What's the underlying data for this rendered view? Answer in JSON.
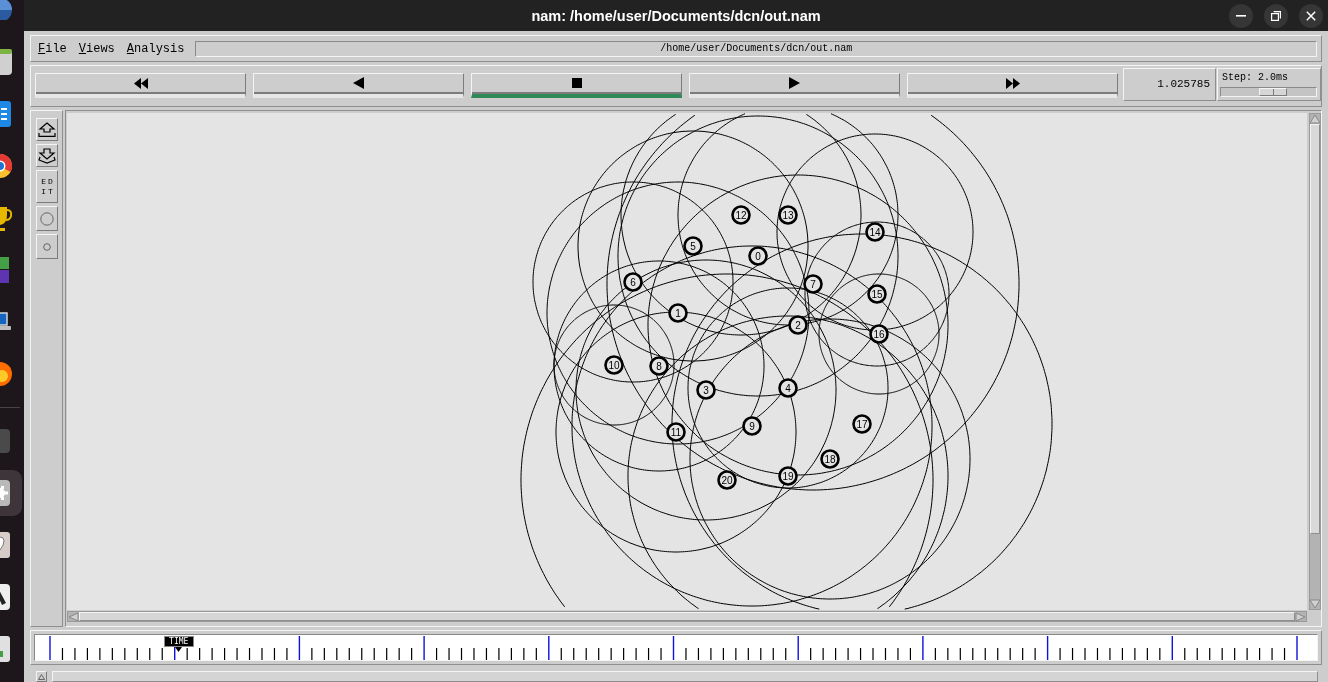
{
  "window": {
    "title": "nam: /home/user/Documents/dcn/out.nam",
    "controls": [
      {
        "kind": "minimize"
      },
      {
        "kind": "maximize"
      },
      {
        "kind": "close"
      }
    ]
  },
  "dock": {
    "items": [
      {
        "selected": false
      },
      {
        "selected": false
      },
      {
        "selected": false
      },
      {
        "selected": false
      },
      {
        "selected": false
      },
      {
        "selected": false
      },
      {
        "selected": false
      },
      {
        "selected": false
      },
      {
        "selected": false
      },
      {
        "selected": true
      },
      {
        "selected": false
      },
      {
        "selected": false
      },
      {
        "selected": false
      }
    ]
  },
  "menu": {
    "items": [
      {
        "label": "File"
      },
      {
        "label": "Views"
      },
      {
        "label": "Analysis"
      }
    ],
    "file_path": "/home/user/Documents/dcn/out.nam"
  },
  "playback": {
    "buttons": [
      {
        "kind": "rewind",
        "selected": false
      },
      {
        "kind": "back",
        "selected": false
      },
      {
        "kind": "stop",
        "selected": true
      },
      {
        "kind": "play",
        "selected": false
      },
      {
        "kind": "fast_forward",
        "selected": false
      }
    ],
    "time": "1.025785",
    "step": {
      "label": "Step: 2.0ms",
      "level": 0.56
    }
  },
  "tools": [
    {
      "kind": "zoom_in"
    },
    {
      "kind": "zoom_out"
    },
    {
      "kind": "edit",
      "label": "EDIT"
    },
    {
      "kind": "node_large"
    },
    {
      "kind": "node_small"
    }
  ],
  "network": {
    "nodes": [
      {
        "label": "0"
      },
      {
        "label": "1"
      },
      {
        "label": "2"
      },
      {
        "label": "3"
      },
      {
        "label": "4"
      },
      {
        "label": "5"
      },
      {
        "label": "6"
      },
      {
        "label": "7"
      },
      {
        "label": "8"
      },
      {
        "label": "9"
      },
      {
        "label": "10"
      },
      {
        "label": "11"
      },
      {
        "label": "12"
      },
      {
        "label": "13"
      },
      {
        "label": "14"
      },
      {
        "label": "15"
      },
      {
        "label": "16"
      },
      {
        "label": "17"
      },
      {
        "label": "18"
      },
      {
        "label": "19"
      },
      {
        "label": "20"
      }
    ]
  },
  "timeline": {
    "marker": {
      "label": "TIME",
      "level": 0.11
    }
  }
}
